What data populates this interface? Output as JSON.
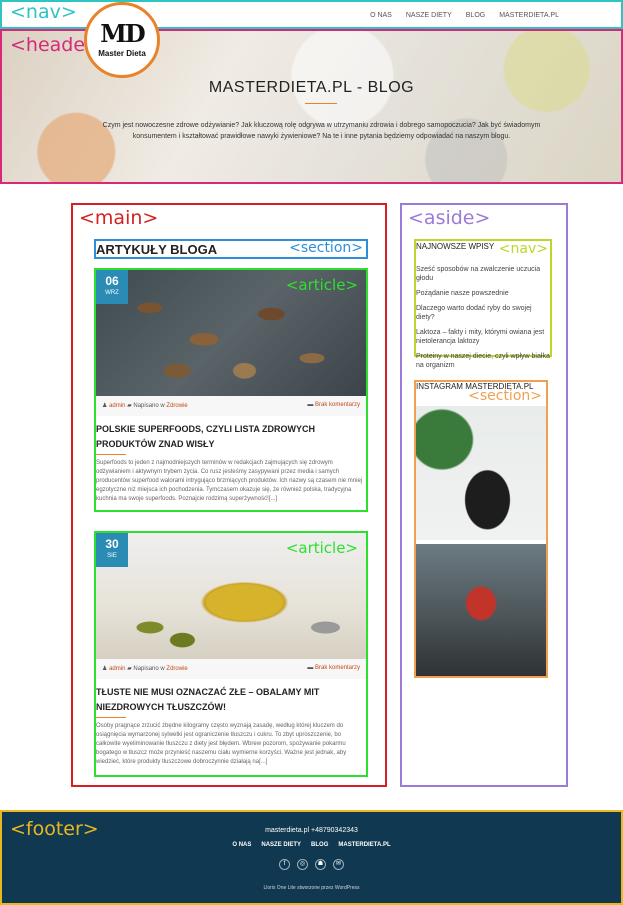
{
  "annotations": {
    "nav": "<nav>",
    "header": "<header>",
    "main": "<main>",
    "section": "<section>",
    "article": "<article>",
    "aside": "<aside>",
    "aside_nav": "<nav>",
    "aside_section": "<section>",
    "footer": "<footer>"
  },
  "nav": {
    "items": [
      "O NAS",
      "NASZE DIETY",
      "BLOG",
      "MASTERDIETA.PL"
    ]
  },
  "logo": {
    "mark": "MD",
    "text": "Master Dieta"
  },
  "header": {
    "title": "MASTERDIETA.PL - BLOG",
    "description": "Czym jest nowoczesne zdrowe odżywianie? Jak kluczową rolę odgrywa w utrzymaniu zdrowia i dobrego samopoczucia? Jak być świadomym konsumentem i kształtować prawidłowe nawyki żywieniowe? Na te i inne pytania będziemy odpowiadać na naszym blogu."
  },
  "main": {
    "section_title": "ARTYKUŁY BLOGA",
    "articles": [
      {
        "day": "06",
        "month": "WRZ",
        "author": "admin",
        "category_prefix": "Napisano w",
        "category": "Zdrowie",
        "comments": "Brak komentarzy",
        "title": "POLSKIE SUPERFOODS, CZYLI LISTA ZDROWYCH PRODUKTÓW ZNAD WISŁY",
        "excerpt": "Superfoods to jeden z najmodniejszych terminów w redakcjach zajmujących się zdrowym odżywianiem i aktywnym trybem życia. Co rusz jesteśmy zasypywani przez media i samych producentów superfood walorami intrygująco brzmiących produktów. Ich nazwy są czasem nie mniej egzotyczne niż miejsca ich pochodzenia. Tymczasem okazuje się, że również polska, tradycyjna kuchnia ma swoje superfoods. Poznajcie rodzimą superżywność![...]"
      },
      {
        "day": "30",
        "month": "SIE",
        "author": "admin",
        "category_prefix": "Napisano w",
        "category": "Zdrowie",
        "comments": "Brak komentarzy",
        "title": "TŁUSTE NIE MUSI OZNACZAĆ ZŁE – OBALAMY MIT NIEZDROWYCH TŁUSZCZÓW!",
        "excerpt": "Osoby pragnące zrzucić zbędne kilogramy często wyznają zasadę, według której kluczem do osiągnięcia wymarzonej sylwetki jest ograniczenie tłuszczu i cukru. To zbyt uproszczenie, bo całkowite wyeliminowanie tłuszczu z diety jest błędem. Wbrew pozorom, spożywanie pokarmu bogatego w tłuszcz może przynieść naszemu ciału wymierne korzyści. Ważne jest jednak, aby wiedzieć, które produkty tłuszczowe dobroczynnie działają na[...]"
      }
    ]
  },
  "aside": {
    "nav_title": "NAJNOWSZE WPISY",
    "recent_posts": [
      "Sześć sposobów na zwalczenie uczucia głodu",
      "Pożądanie nasze powszednie",
      "Dlaczego warto dodać ryby do swojej diety?",
      "Laktoza – fakty i mity, którymi owiana jest nietolerancja laktozy",
      "Proteiny w naszej diecie, czyli wpływ białka na organizm"
    ],
    "instagram_title": "INSTAGRAM MASTERDIETA.PL"
  },
  "footer": {
    "contact": "masterdieta.pl +48790342343",
    "menu": [
      "O NAS",
      "NASZE DIETY",
      "BLOG",
      "MASTERDIETA.PL"
    ],
    "social_icons": [
      "facebook-icon",
      "instagram-icon",
      "bag-icon",
      "chat-icon"
    ],
    "social_glyphs": [
      "f",
      "◎",
      "☗",
      "✉"
    ],
    "credit": "Llorix One Lite stworzone przez WordPress"
  }
}
